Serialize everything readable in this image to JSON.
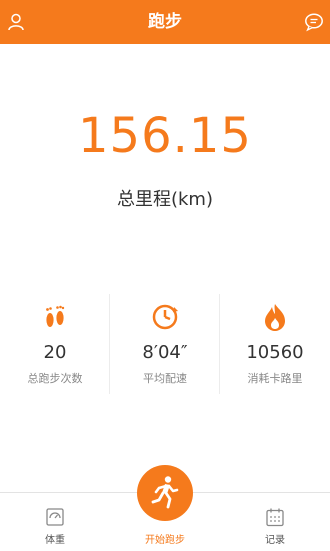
{
  "header": {
    "title": "跑步"
  },
  "summary": {
    "total_distance": "156.15",
    "total_label": "总里程(km)"
  },
  "stats": [
    {
      "value": "20",
      "label": "总跑步次数",
      "icon": "footprints-icon"
    },
    {
      "value": "8′04″",
      "label": "平均配速",
      "icon": "timer-icon"
    },
    {
      "value": "10560",
      "label": "消耗卡路里",
      "icon": "flame-icon"
    }
  ],
  "tabs": [
    {
      "label": "体重",
      "icon": "scale-icon"
    },
    {
      "label": "开始跑步",
      "icon": "runner-icon"
    },
    {
      "label": "记录",
      "icon": "calendar-icon"
    }
  ],
  "colors": {
    "accent": "#f57a1c"
  }
}
